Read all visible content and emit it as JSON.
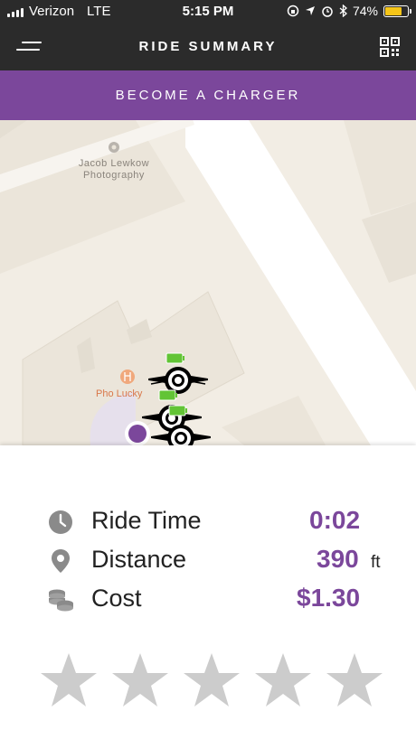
{
  "status_bar": {
    "carrier": "Verizon",
    "network": "LTE",
    "time": "5:15 PM",
    "battery_percent_label": "74%",
    "battery_level": 0.74,
    "icons": [
      "signal-icon",
      "screen-rotation-lock-icon",
      "location-icon",
      "alarm-icon",
      "bluetooth-icon",
      "battery-icon"
    ]
  },
  "header": {
    "title": "RIDE SUMMARY",
    "menu_icon": "menu-icon",
    "qr_icon": "qr-code-icon"
  },
  "promo": {
    "label": "BECOME A CHARGER"
  },
  "map": {
    "places": [
      {
        "name": "Jacob Lewkow Photography"
      },
      {
        "name": "Pho Lucky"
      }
    ],
    "colors": {
      "land": "#f2ede4",
      "road": "#ffffff",
      "building": "#ebe5da",
      "marker": "#7b479b",
      "battery": "#62c435",
      "restaurant_label": "#d9784a"
    }
  },
  "summary": {
    "ride_time": {
      "label": "Ride Time",
      "value": "0:02",
      "icon": "clock-icon"
    },
    "distance": {
      "label": "Distance",
      "value": "390",
      "unit": "ft",
      "icon": "location-pin-icon"
    },
    "cost": {
      "label": "Cost",
      "value": "$1.30",
      "icon": "coins-icon"
    }
  },
  "rating": {
    "max_stars": 5,
    "selected": 0,
    "star_color": "#cccccc"
  },
  "colors": {
    "accent": "#7b479b",
    "header_bg": "#2b2b2b"
  }
}
